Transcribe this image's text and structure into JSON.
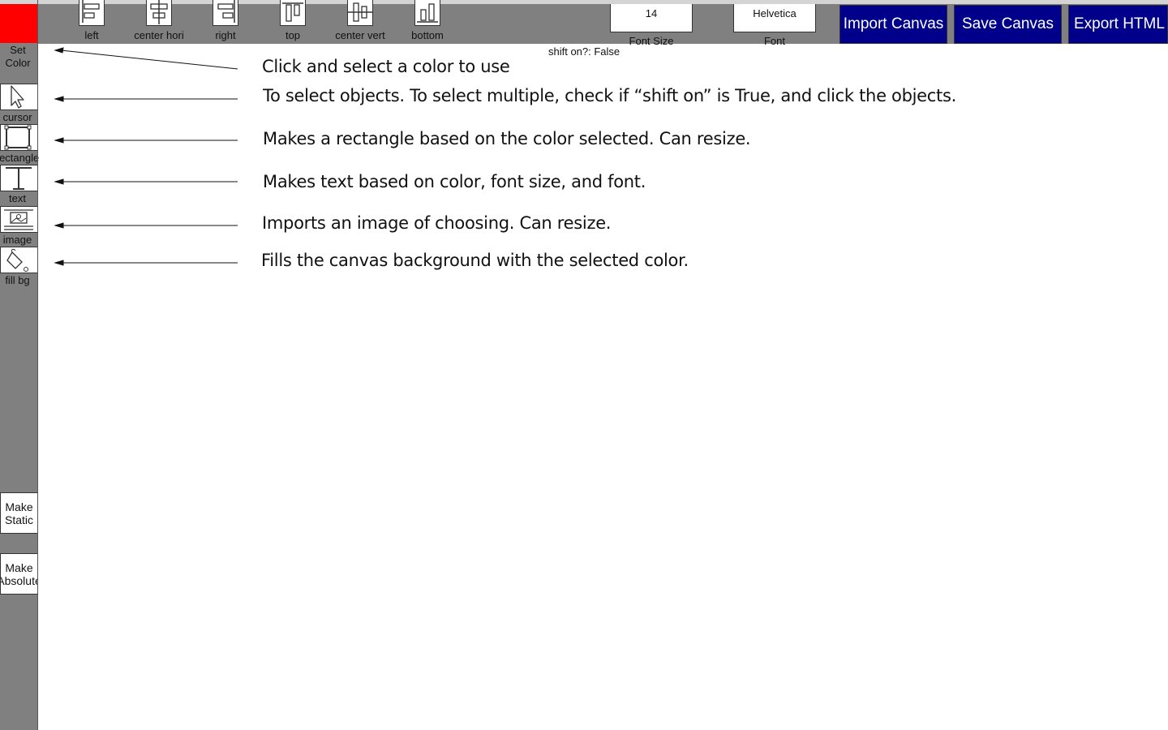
{
  "toolbar": {
    "align_buttons": [
      {
        "label": "left",
        "icon": "align-left-icon"
      },
      {
        "label": "center hori",
        "icon": "align-center-horizontal-icon"
      },
      {
        "label": "right",
        "icon": "align-right-icon"
      },
      {
        "label": "top",
        "icon": "align-top-icon"
      },
      {
        "label": "center vert",
        "icon": "align-center-vertical-icon"
      },
      {
        "label": "bottom",
        "icon": "align-bottom-icon"
      }
    ],
    "font_size": {
      "value": "14",
      "label": "Font Size"
    },
    "font": {
      "value": "Helvetica",
      "label": "Font"
    },
    "import_label": "Import Canvas",
    "save_label": "Save Canvas",
    "export_label": "Export HTML",
    "button_color": "#00008b"
  },
  "status": {
    "shift": "shift on?: False"
  },
  "sidebar": {
    "color": {
      "label_line1": "Set",
      "label_line2": "Color",
      "swatch": "#ff0000"
    },
    "tools": [
      {
        "label": "cursor",
        "icon": "cursor-icon"
      },
      {
        "label": "rectangle",
        "icon": "rectangle-icon"
      },
      {
        "label": "text",
        "icon": "text-icon"
      },
      {
        "label": "image",
        "icon": "image-icon"
      },
      {
        "label": "fill bg",
        "icon": "fill-bucket-icon"
      }
    ],
    "make_static": "Make Static",
    "make_absolute": "Make Absolute"
  },
  "instructions": [
    "Click and select a color to use",
    "To select objects. To select multiple, check if “shift on” is True, and click the objects.",
    "Makes a rectangle based on the color selected. Can resize.",
    "Makes text based on color, font size, and font.",
    "Imports an image of choosing. Can resize.",
    "Fills the canvas background with the selected color."
  ]
}
